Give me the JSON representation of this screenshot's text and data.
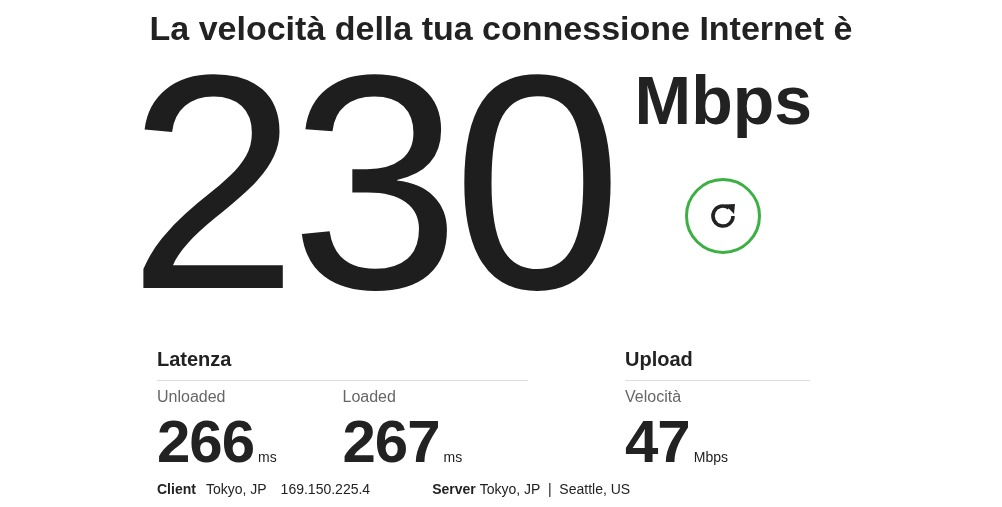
{
  "headline": "La velocità della tua connessione Internet è",
  "speed": {
    "value": "230",
    "unit": "Mbps"
  },
  "latency": {
    "title": "Latenza",
    "metrics": [
      {
        "label": "Unloaded",
        "value": "266",
        "unit": "ms"
      },
      {
        "label": "Loaded",
        "value": "267",
        "unit": "ms"
      }
    ]
  },
  "upload": {
    "title": "Upload",
    "metrics": [
      {
        "label": "Velocità",
        "value": "47",
        "unit": "Mbps"
      }
    ]
  },
  "footer": {
    "client_label": "Client",
    "client_location": "Tokyo, JP",
    "client_ip": "169.150.225.4",
    "server_label": "Server",
    "server_locations": "Tokyo, JP  |  Seattle, US"
  }
}
